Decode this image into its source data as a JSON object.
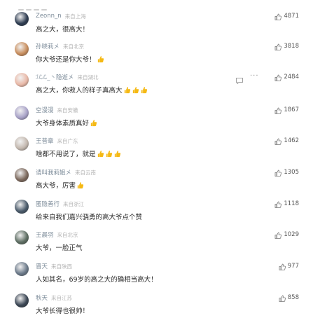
{
  "comments": [
    {
      "user": "Zeonn_n",
      "source": "来自上海",
      "text": "高之大，很高大！",
      "emojis": 0,
      "likes": "4871",
      "avatar_color": "#2f3d52"
    },
    {
      "user": "孙晓莉㐅",
      "source": "来自北京",
      "text": "你大爷还是你大爷！",
      "emojis": 1,
      "likes": "3818",
      "avatar_color": "#c98f5f"
    },
    {
      "user": "ℐℒℒ_丶隐逝㐅",
      "source": "来自湖北",
      "text": "高之大，你救人的样子真高大",
      "emojis": 3,
      "likes": "2484",
      "avatar_color": "#e9b9a8"
    },
    {
      "user": "空漫漫",
      "source": "来自安徽",
      "text": "大爷身体素质真好",
      "emojis": 1,
      "likes": "1867",
      "avatar_color": "#a9a3c8"
    },
    {
      "user": "王普章",
      "source": "来自广东",
      "text": "啥都不用说了，就是",
      "emojis": 3,
      "likes": "1462",
      "avatar_color": "#c4b9b0"
    },
    {
      "user": "请叫我莉姐㐅",
      "source": "来自云南",
      "text": "高大爷，厉害",
      "emojis": 1,
      "likes": "1305",
      "avatar_color": "#7d6a5e"
    },
    {
      "user": "匿隐善行",
      "source": "来自浙江",
      "text": "给来自我们嘉兴骁勇的高大爷点个赞",
      "emojis": 0,
      "likes": "1118",
      "avatar_color": "#4a5a6a"
    },
    {
      "user": "王晨羽",
      "source": "来自北京",
      "text": "大爷，一脸正气",
      "emojis": 0,
      "likes": "1029",
      "avatar_color": "#5e6e63"
    },
    {
      "user": "晋天",
      "source": "来自陕西",
      "text": "人如其名，69岁的高之大的确相当高大！",
      "emojis": 0,
      "likes": "977",
      "avatar_color": "#6c7a8a"
    },
    {
      "user": "秋天",
      "source": "来自江苏",
      "text": "大爷长得也很帅！",
      "emojis": 0,
      "likes": "858",
      "avatar_color": "#3b4654"
    }
  ],
  "accent_colors": {
    "username": "#7c8b99",
    "source": "#b3b3b3",
    "emoji": "#f5b914"
  },
  "icons": {
    "like": "thumbs-up-icon",
    "reply": "comment-icon",
    "more": "more-icon",
    "emoji": "thumbs-up-emoji"
  }
}
